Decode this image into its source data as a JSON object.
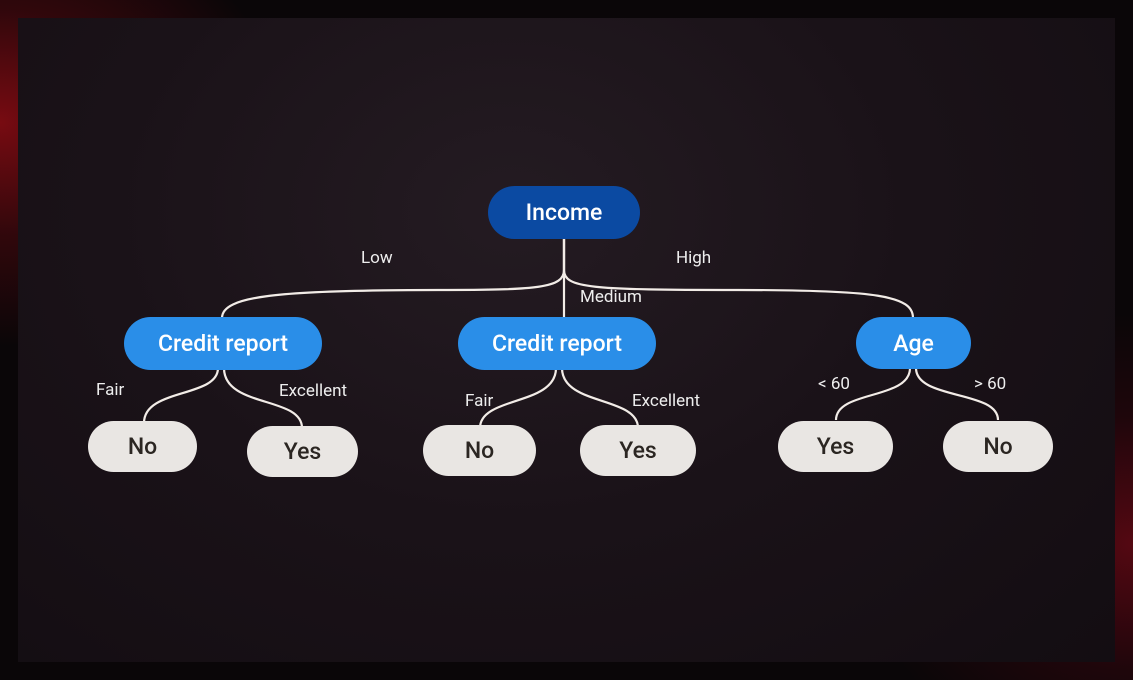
{
  "root": {
    "label": "Income"
  },
  "edges": {
    "low": "Low",
    "medium": "Medium",
    "high": "High",
    "fair1": "Fair",
    "excellent1": "Excellent",
    "fair2": "Fair",
    "excellent2": "Excellent",
    "lt60": "< 60",
    "gt60": "> 60"
  },
  "mid": {
    "credit1": "Credit report",
    "credit2": "Credit report",
    "age": "Age"
  },
  "leaf": {
    "no1": "No",
    "yes1": "Yes",
    "no2": "No",
    "yes2": "Yes",
    "yes3": "Yes",
    "no3": "No"
  }
}
